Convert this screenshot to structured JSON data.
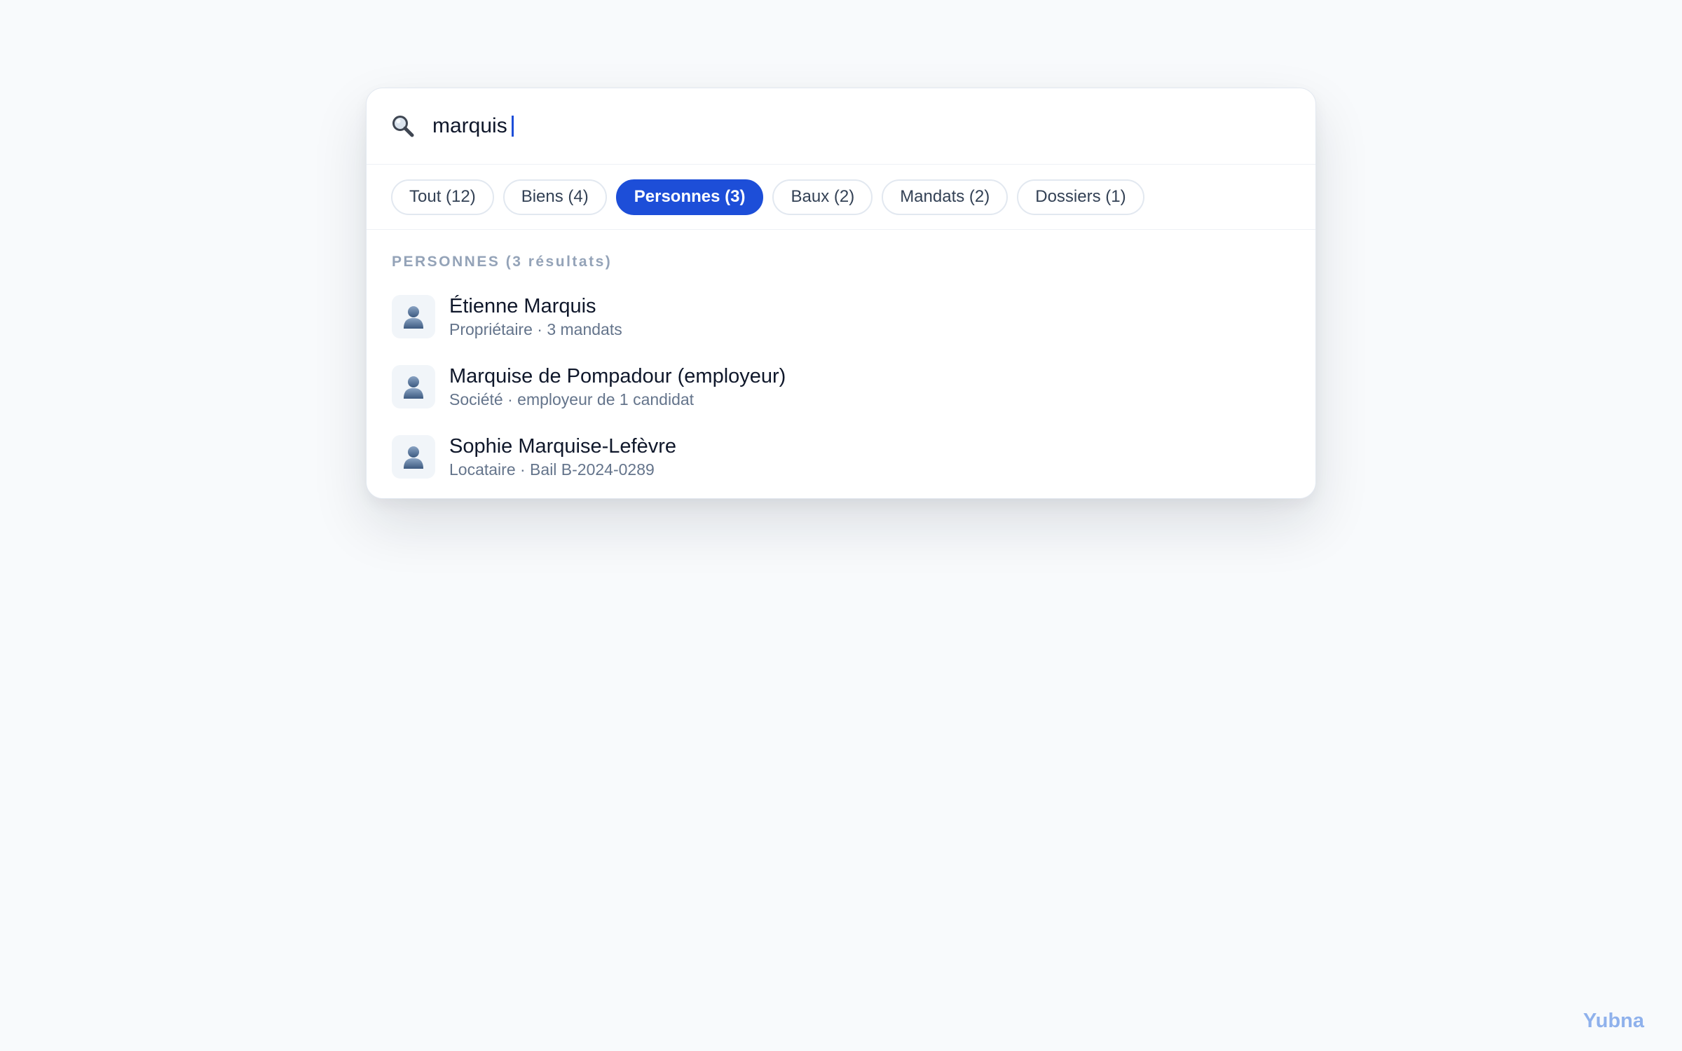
{
  "search": {
    "query": "marquis"
  },
  "filters": [
    {
      "label": "Tout (12)",
      "active": false
    },
    {
      "label": "Biens (4)",
      "active": false
    },
    {
      "label": "Personnes (3)",
      "active": true
    },
    {
      "label": "Baux (2)",
      "active": false
    },
    {
      "label": "Mandats (2)",
      "active": false
    },
    {
      "label": "Dossiers (1)",
      "active": false
    }
  ],
  "section": {
    "heading": "PERSONNES (3 résultats)"
  },
  "results": [
    {
      "name": "Étienne Marquis",
      "meta": "Propriétaire · 3 mandats",
      "icon": "person-icon"
    },
    {
      "name": "Marquise de Pompadour (employeur)",
      "meta": "Société · employeur de 1 candidat",
      "icon": "person-icon"
    },
    {
      "name": "Sophie Marquise-Lefèvre",
      "meta": "Locataire · Bail B-2024-0289",
      "icon": "person-icon"
    }
  ],
  "brand": "Yubna",
  "colors": {
    "accent": "#1d4ed8",
    "background": "#f8fafc",
    "brand": "#8fb1ec"
  }
}
